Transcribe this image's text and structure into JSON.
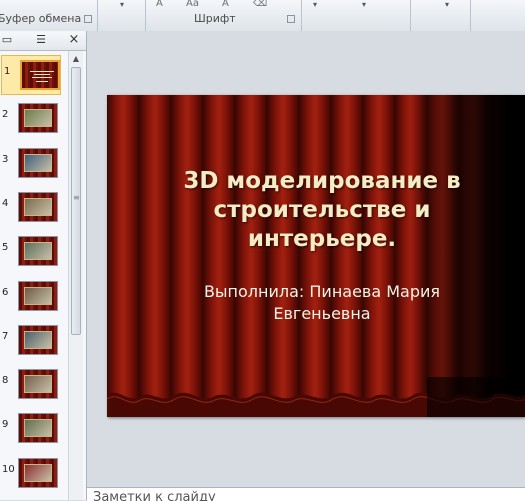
{
  "ribbon": {
    "groups": [
      {
        "label": "Буфер обмена"
      },
      {
        "label": "Шрифт"
      }
    ],
    "font_mini_labels": [
      "A",
      "Aa",
      "A"
    ]
  },
  "panel": {
    "close_glyph": "×",
    "slides": [
      {
        "number": "1",
        "selected": true
      },
      {
        "number": "2"
      },
      {
        "number": "3"
      },
      {
        "number": "4"
      },
      {
        "number": "5"
      },
      {
        "number": "6"
      },
      {
        "number": "7"
      },
      {
        "number": "8"
      },
      {
        "number": "9"
      },
      {
        "number": "10"
      }
    ]
  },
  "slide": {
    "title": "3D моделирование в строительстве и интерьере.",
    "subtitle": "Выполнила: Пинаева Мария Евгеньевна"
  },
  "notes": {
    "placeholder": "Заметки к слайду"
  },
  "colors": {
    "title_text": "#f3ecc4",
    "selection": "#e8a530",
    "curtain": "#7a1209"
  }
}
